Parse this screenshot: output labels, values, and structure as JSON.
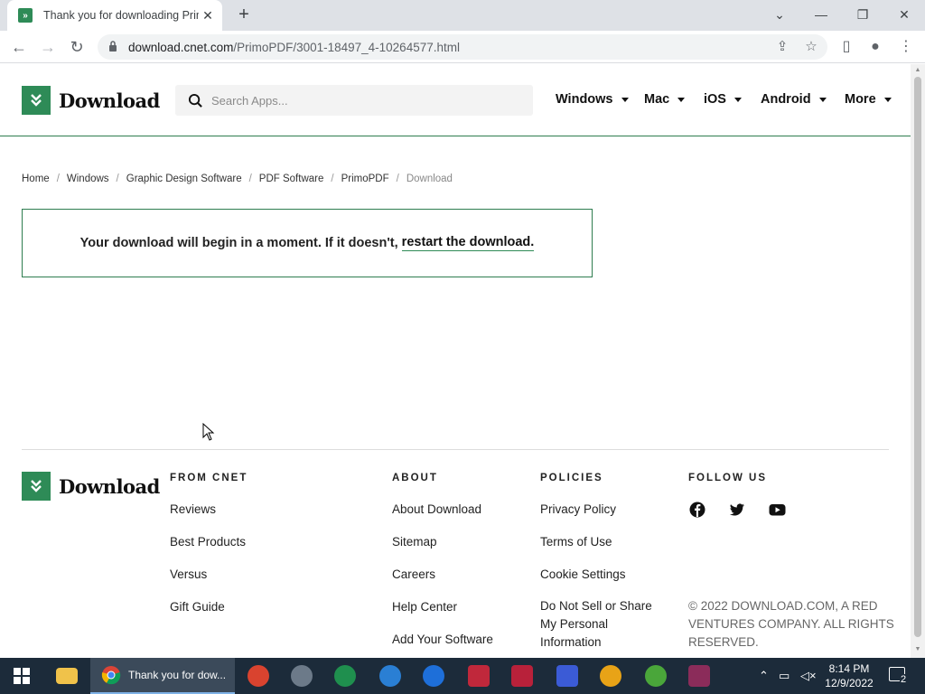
{
  "browser": {
    "tab_title": "Thank you for downloading PrimoPDF",
    "url_host": "download.cnet.com",
    "url_path": "/PrimoPDF/3001-18497_4-10264577.html"
  },
  "header": {
    "logo_text": "Download",
    "search_placeholder": "Search Apps...",
    "nav": [
      "Windows",
      "Mac",
      "iOS",
      "Android",
      "More"
    ]
  },
  "breadcrumb": [
    "Home",
    "Windows",
    "Graphic Design Software",
    "PDF Software",
    "PrimoPDF",
    "Download"
  ],
  "message": {
    "text": "Your download will begin in a moment. If it doesn't,",
    "link": "restart the download."
  },
  "footer": {
    "logo_text": "Download",
    "from_cnet": {
      "heading": "FROM CNET",
      "links": [
        "Reviews",
        "Best Products",
        "Versus",
        "Gift Guide"
      ]
    },
    "about": {
      "heading": "ABOUT",
      "links": [
        "About Download",
        "Sitemap",
        "Careers",
        "Help Center",
        "Add Your Software"
      ]
    },
    "policies": {
      "heading": "POLICIES",
      "links": [
        "Privacy Policy",
        "Terms of Use",
        "Cookie Settings",
        "Do Not Sell or Share My Personal Information"
      ]
    },
    "follow": {
      "heading": "FOLLOW US",
      "icons": [
        "facebook-icon",
        "twitter-icon",
        "youtube-icon"
      ]
    },
    "copyright": "© 2022 DOWNLOAD.COM, A RED VENTURES COMPANY. ALL RIGHTS RESERVED."
  },
  "taskbar": {
    "active_window": "Thank you for dow...",
    "time": "8:14 PM",
    "date": "12/9/2022",
    "notification_count": "2"
  },
  "colors": {
    "brand_green": "#2e8b57",
    "taskbar": "#1c2b3a"
  }
}
